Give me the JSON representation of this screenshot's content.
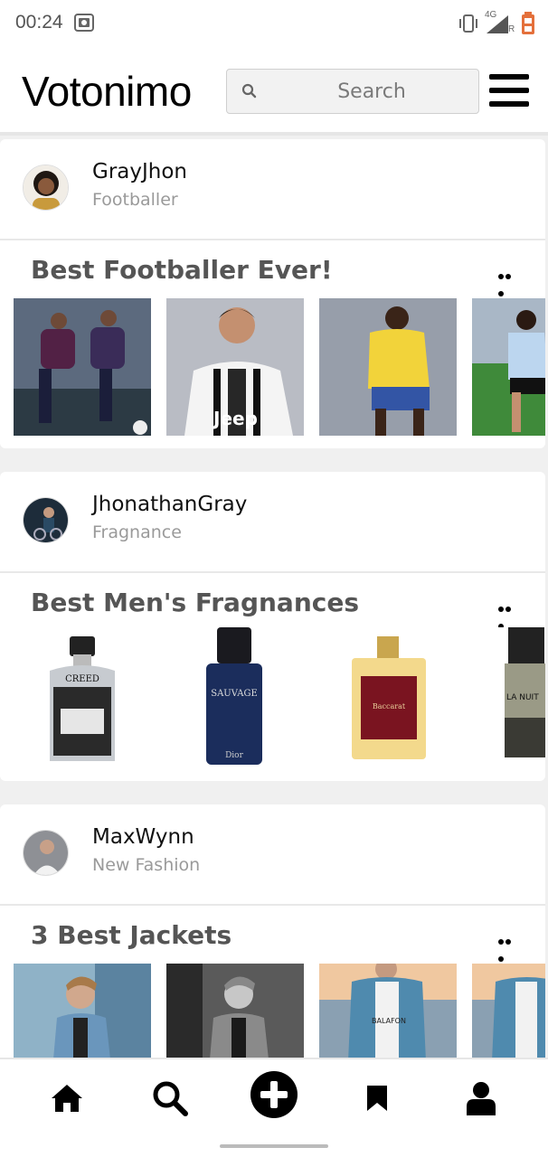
{
  "status_bar": {
    "time": "00:24",
    "network": "4G",
    "roaming": "R",
    "icons": [
      "screenshot-icon",
      "vibrate-icon",
      "signal-icon",
      "battery-icon"
    ]
  },
  "header": {
    "title": "Votonimo",
    "search": {
      "placeholder": "Search",
      "value": ""
    },
    "icons": [
      "search-icon",
      "menu-icon"
    ]
  },
  "posts": [
    {
      "user_name": "GrayJhon",
      "user_tag": "Footballer",
      "title": "Best Footballer Ever!",
      "more_icon": "more-horizontal-icon",
      "images": [
        "footballer-image-1",
        "footballer-image-2",
        "footballer-image-3",
        "footballer-image-4"
      ]
    },
    {
      "user_name": "JhonathanGray",
      "user_tag": "Fragnance",
      "title": "Best Men's Fragnances",
      "more_icon": "more-horizontal-icon",
      "images": [
        "fragrance-image-1",
        "fragrance-image-2",
        "fragrance-image-3",
        "fragrance-image-4"
      ]
    },
    {
      "user_name": "MaxWynn",
      "user_tag": "New Fashion",
      "title": "3 Best Jackets",
      "more_icon": "more-horizontal-icon",
      "images": [
        "jacket-image-1",
        "jacket-image-2",
        "jacket-image-3",
        "jacket-image-4"
      ]
    }
  ],
  "bottom_nav": {
    "items": [
      "home-icon",
      "search-icon",
      "add-icon",
      "bookmark-icon",
      "profile-icon"
    ]
  },
  "colors": {
    "background": "#f0f0f0",
    "card": "#ffffff",
    "title_text": "#555555",
    "secondary_text": "#9a9a9a",
    "accent": "#000000"
  }
}
